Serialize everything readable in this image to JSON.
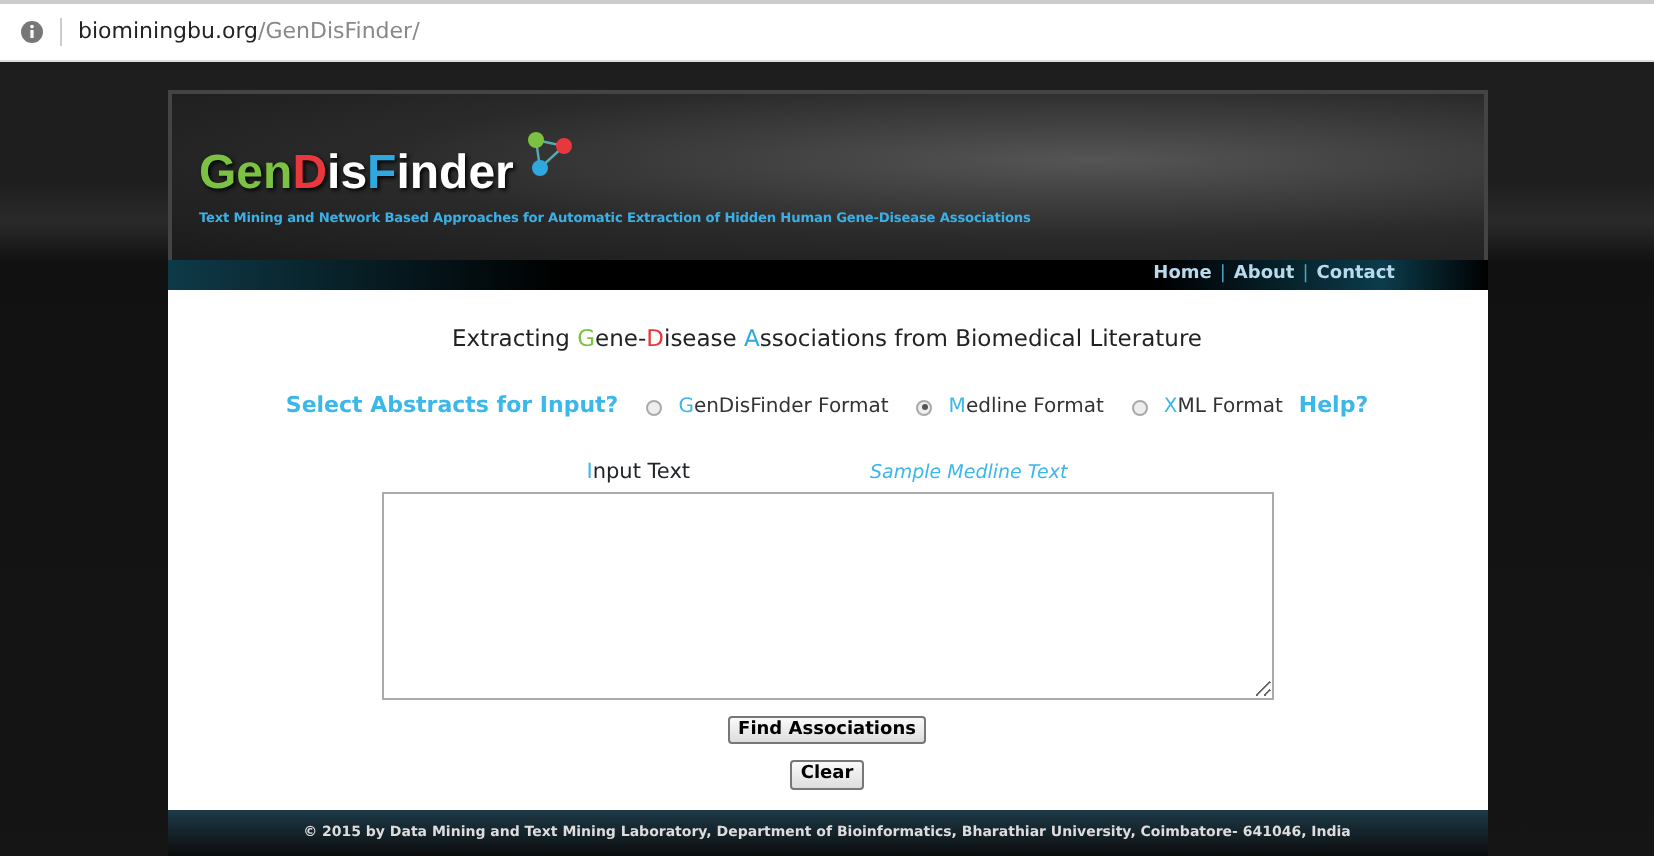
{
  "address_bar": {
    "domain": "biominingbu.org",
    "path": "/GenDisFinder/"
  },
  "header": {
    "logo": [
      {
        "text": "Gen",
        "color": "#7cc242"
      },
      {
        "text": "D",
        "color": "#e8383d"
      },
      {
        "text": "is",
        "color": "#ffffff"
      },
      {
        "text": "F",
        "color": "#2fa8e0"
      },
      {
        "text": "inder",
        "color": "#ffffff"
      }
    ],
    "tagline": "Text Mining and Network Based Approaches for Automatic Extraction of Hidden Human Gene-Disease Associations",
    "nav": [
      {
        "kind": "link",
        "text": "Home"
      },
      {
        "kind": "separator",
        "text": "|"
      },
      {
        "kind": "link",
        "text": "About"
      },
      {
        "kind": "separator",
        "text": "|"
      },
      {
        "kind": "link",
        "text": "Contact"
      }
    ]
  },
  "heading": [
    {
      "text": "Extracting "
    },
    {
      "text": "G",
      "color": "#7cc242"
    },
    {
      "text": "ene-"
    },
    {
      "text": "D",
      "color": "#e8383d"
    },
    {
      "text": "isease "
    },
    {
      "text": "A",
      "color": "#2fa8e0"
    },
    {
      "text": "ssociations from Biomedical Literature"
    }
  ],
  "format_prompt": "Select Abstracts for Input?",
  "formats": [
    {
      "initial": "G",
      "rest": "enDisFinder Format",
      "selected": false
    },
    {
      "initial": "M",
      "rest": "edline Format",
      "selected": true
    },
    {
      "initial": "X",
      "rest": "ML Format",
      "selected": false
    }
  ],
  "help_link": "Help?",
  "input_label": {
    "initial": "I",
    "rest": "nput Text"
  },
  "sample_link": "Sample Medline Text",
  "buttons": [
    "Find Associations",
    "Clear"
  ],
  "footer": "© 2015 by Data Mining and Text Mining Laboratory, Department of Bioinformatics, Bharathiar University, Coimbatore- 641046, India"
}
